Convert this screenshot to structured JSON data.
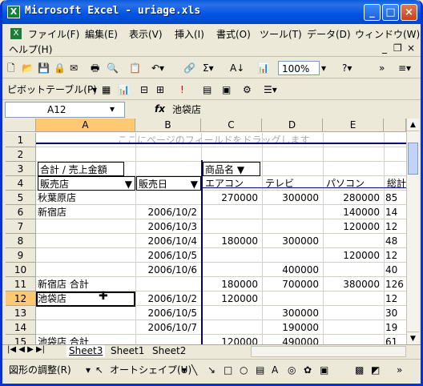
{
  "window": {
    "title": "Microsoft Excel - uriage.xls"
  },
  "menu": [
    "ファイル(F)",
    "編集(E)",
    "表示(V)",
    "挿入(I)",
    "書式(O)",
    "ツール(T)",
    "データ(D)",
    "ウィンドウ(W)",
    "ヘルプ(H)"
  ],
  "toolbar": {
    "zoom": "100%",
    "pivot_label": "ピボットテーブル(P)"
  },
  "formula": {
    "name_box": "A12",
    "fx": "fx",
    "value": "池袋店"
  },
  "columns": [
    "A",
    "B",
    "C",
    "D",
    "E"
  ],
  "rows": [
    "1",
    "2",
    "3",
    "4",
    "5",
    "6",
    "7",
    "8",
    "9",
    "10",
    "11",
    "12",
    "13",
    "14",
    "15"
  ],
  "pivot": {
    "page_hint": "ここにページのフィールドをドラッグします",
    "data_field": "合計 / 売上金額",
    "col_field": "商品名",
    "row_fields": [
      "販売店",
      "販売日"
    ],
    "col_items": [
      "エアコン",
      "テレビ",
      "パソコン",
      "総計"
    ],
    "rows": [
      {
        "r": 5,
        "a": "秋葉原店",
        "b": "",
        "c": "270000",
        "d": "300000",
        "e": "280000",
        "f": "85"
      },
      {
        "r": 6,
        "a": "新宿店",
        "b": "2006/10/2",
        "c": "",
        "d": "",
        "e": "140000",
        "f": "14"
      },
      {
        "r": 7,
        "a": "",
        "b": "2006/10/3",
        "c": "",
        "d": "",
        "e": "120000",
        "f": "12"
      },
      {
        "r": 8,
        "a": "",
        "b": "2006/10/4",
        "c": "180000",
        "d": "300000",
        "e": "",
        "f": "48"
      },
      {
        "r": 9,
        "a": "",
        "b": "2006/10/5",
        "c": "",
        "d": "",
        "e": "120000",
        "f": "12"
      },
      {
        "r": 10,
        "a": "",
        "b": "2006/10/6",
        "c": "",
        "d": "400000",
        "e": "",
        "f": "40"
      },
      {
        "r": 11,
        "a": "新宿店 合計",
        "b": "",
        "c": "180000",
        "d": "700000",
        "e": "380000",
        "f": "126"
      },
      {
        "r": 12,
        "a": "池袋店",
        "b": "2006/10/2",
        "c": "120000",
        "d": "",
        "e": "",
        "f": "12"
      },
      {
        "r": 13,
        "a": "",
        "b": "2006/10/5",
        "c": "",
        "d": "300000",
        "e": "",
        "f": "30"
      },
      {
        "r": 14,
        "a": "",
        "b": "2006/10/7",
        "c": "",
        "d": "190000",
        "e": "",
        "f": "19"
      },
      {
        "r": 15,
        "a": "池袋店 合計",
        "b": "",
        "c": "120000",
        "d": "490000",
        "e": "",
        "f": "61"
      }
    ]
  },
  "sheet_tabs": [
    "Sheet3",
    "Sheet1",
    "Sheet2"
  ],
  "drawing": {
    "adjust": "図形の調整(R)",
    "autoshape": "オートシェイプ(U)"
  }
}
